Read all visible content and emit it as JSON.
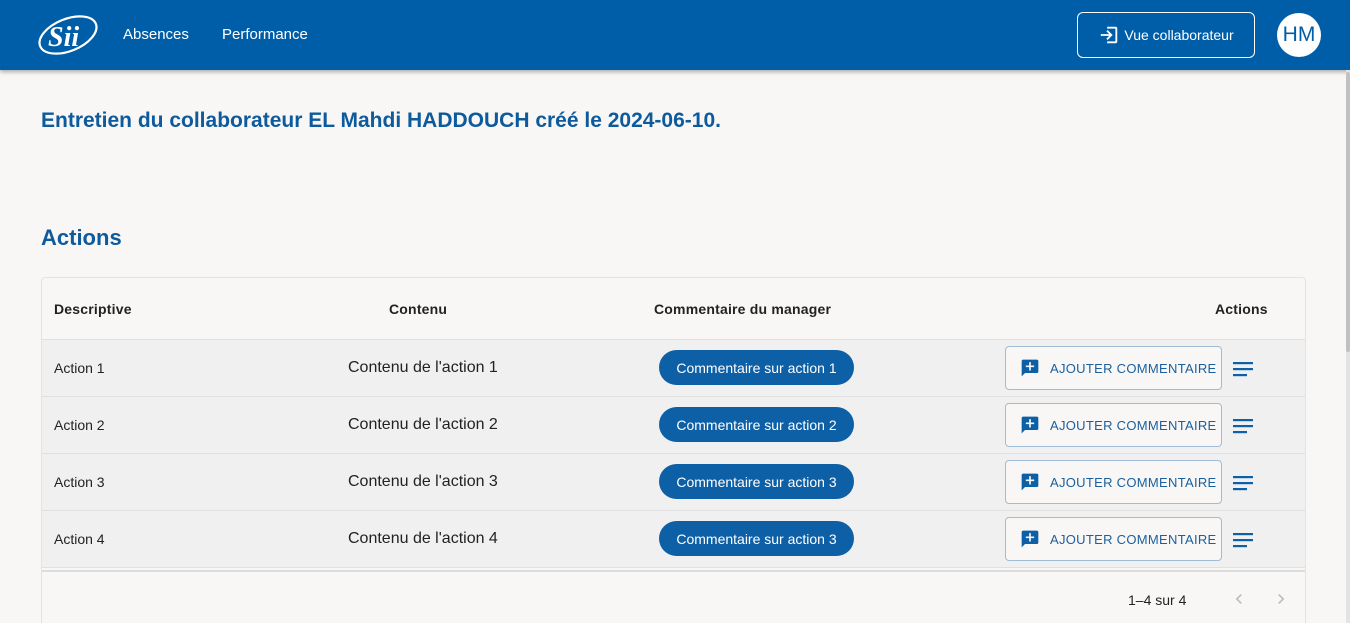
{
  "header": {
    "logo_text": "SII",
    "nav": [
      {
        "label": "Absences"
      },
      {
        "label": "Performance"
      }
    ],
    "switch_view_label": "Vue collaborateur",
    "avatar_initials": "HM"
  },
  "page": {
    "title": "Entretien du collaborateur EL Mahdi HADDOUCH créé le 2024-06-10.",
    "section_title": "Actions"
  },
  "table": {
    "columns": {
      "descriptive": "Descriptive",
      "content": "Contenu",
      "manager_comment": "Commentaire du manager",
      "actions": "Actions"
    },
    "rows": [
      {
        "descriptive": "Action 1",
        "content": "Contenu de l'action 1",
        "comment": "Commentaire sur action 1",
        "add_label": "AJOUTER COMMENTAIRE"
      },
      {
        "descriptive": "Action 2",
        "content": "Contenu de l'action 2",
        "comment": "Commentaire sur action 2",
        "add_label": "AJOUTER COMMENTAIRE"
      },
      {
        "descriptive": "Action 3",
        "content": "Contenu de l'action 3",
        "comment": "Commentaire sur action 3",
        "add_label": "AJOUTER COMMENTAIRE"
      },
      {
        "descriptive": "Action 4",
        "content": "Contenu de l'action 4",
        "comment": "Commentaire sur action 3",
        "add_label": "AJOUTER COMMENTAIRE"
      }
    ],
    "pagination": {
      "label": "1–4 sur 4"
    }
  },
  "icons": {
    "logo": "sii-logo",
    "switch_view": "login-arrow-icon",
    "add_comment": "add-comment-icon",
    "row_menu": "menu-lines-icon",
    "prev": "chevron-left-icon",
    "next": "chevron-right-icon"
  },
  "colors": {
    "brand": "#005ea8",
    "title": "#0d5a9c",
    "chip": "#0d5fa6"
  }
}
